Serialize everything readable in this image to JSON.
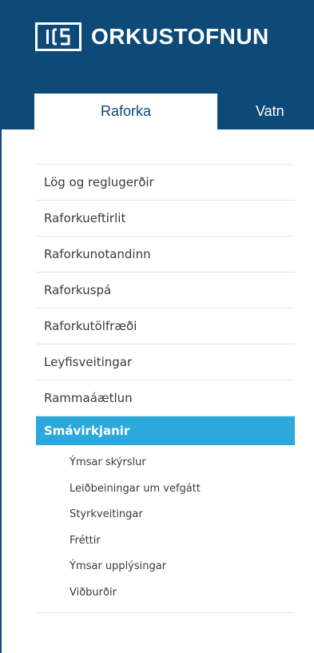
{
  "header": {
    "logo_text": "ORKUSTOFNUN"
  },
  "tabs": [
    {
      "label": "Raforka"
    },
    {
      "label": "Vatn"
    }
  ],
  "nav": {
    "items": [
      {
        "label": "Lög og reglugerðir"
      },
      {
        "label": "Raforkueftirlit"
      },
      {
        "label": "Raforkunotandinn"
      },
      {
        "label": "Raforkuspá"
      },
      {
        "label": "Raforkutölfræði"
      },
      {
        "label": "Leyfisveitingar"
      },
      {
        "label": "Rammaáætlun"
      }
    ],
    "active": {
      "label": "Smávirkjanir"
    },
    "subitems": [
      {
        "label": "Ýmsar skýrslur"
      },
      {
        "label": "Leiðbeiningar um vefgátt"
      },
      {
        "label": "Styrkveitingar"
      },
      {
        "label": "Fréttir"
      },
      {
        "label": "Ýmsar upplýsingar"
      },
      {
        "label": "Viðburðir"
      }
    ]
  },
  "colors": {
    "brand": "#0d4a78",
    "accent": "#2ba8dc"
  }
}
